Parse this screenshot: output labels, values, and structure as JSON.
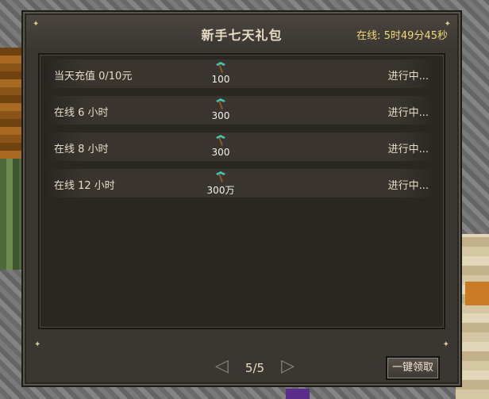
{
  "window": {
    "title": "新手七天礼包",
    "online_label": "在线: 5时49分45秒"
  },
  "rows": [
    {
      "label": "当天充值 0/10元",
      "reward_icon": "diamond-pickaxe-icon",
      "reward_amount": "100",
      "status": "进行中..."
    },
    {
      "label": "在线 6 小时",
      "reward_icon": "diamond-pickaxe-icon",
      "reward_amount": "300",
      "status": "进行中..."
    },
    {
      "label": "在线 8 小时",
      "reward_icon": "diamond-pickaxe-icon",
      "reward_amount": "300",
      "status": "进行中..."
    },
    {
      "label": "在线 12 小时",
      "reward_icon": "diamond-pickaxe-icon",
      "reward_amount": "300万",
      "status": "进行中..."
    }
  ],
  "pager": {
    "page": "5/5"
  },
  "buttons": {
    "claim_all": "一键领取"
  },
  "colors": {
    "panel": "#3a3631",
    "title": "#e8dcc2",
    "online": "#f0d878",
    "pickaxe": "#3ec9b0"
  }
}
